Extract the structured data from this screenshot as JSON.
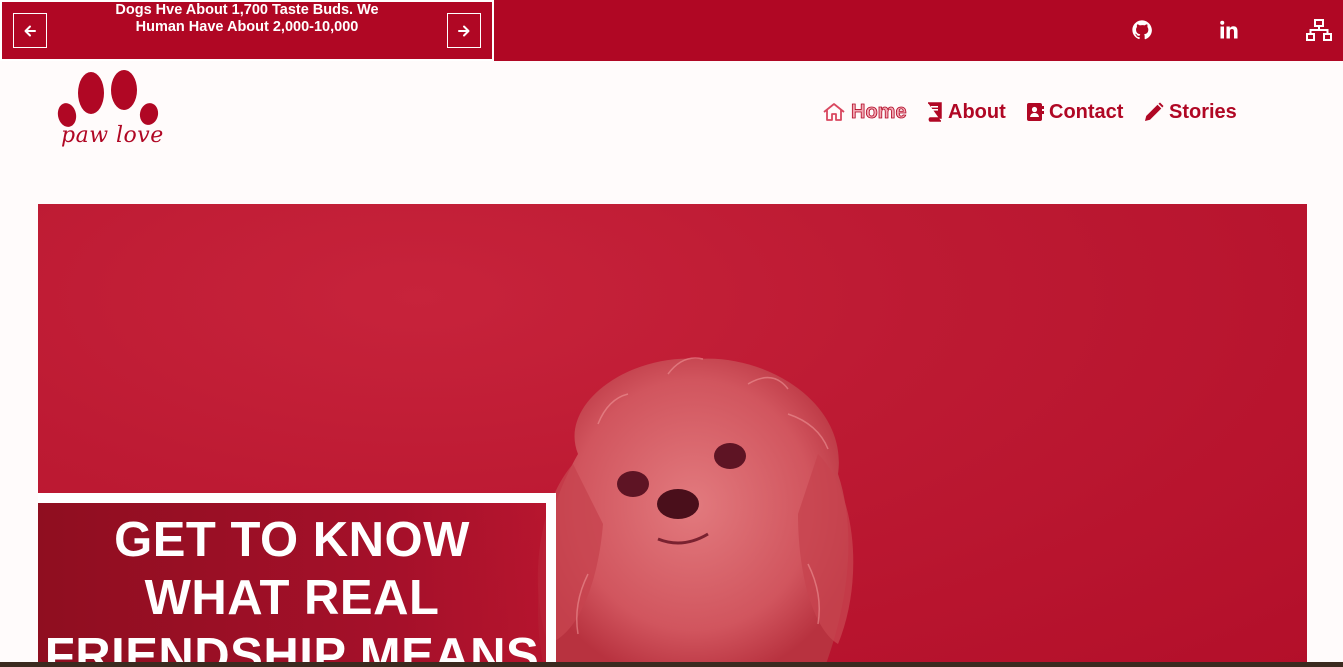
{
  "ticker": {
    "text": "Dogs Hve About 1,700 Taste Buds. We Human Have About 2,000-10,000"
  },
  "social": [
    "github-icon",
    "linkedin-icon",
    "sitemap-icon"
  ],
  "logo": {
    "text": "paw love"
  },
  "nav": [
    {
      "label": "Home",
      "icon": "home-icon"
    },
    {
      "label": "About",
      "icon": "book-icon"
    },
    {
      "label": "Contact",
      "icon": "address-book-icon"
    },
    {
      "label": "Stories",
      "icon": "pencil-icon"
    }
  ],
  "hero": {
    "headline": "GET TO KNOW WHAT REAL FRIENDSHIP MEANS"
  },
  "colors": {
    "brand": "#b00724",
    "background": "#fffbfb",
    "white": "#ffffff"
  }
}
